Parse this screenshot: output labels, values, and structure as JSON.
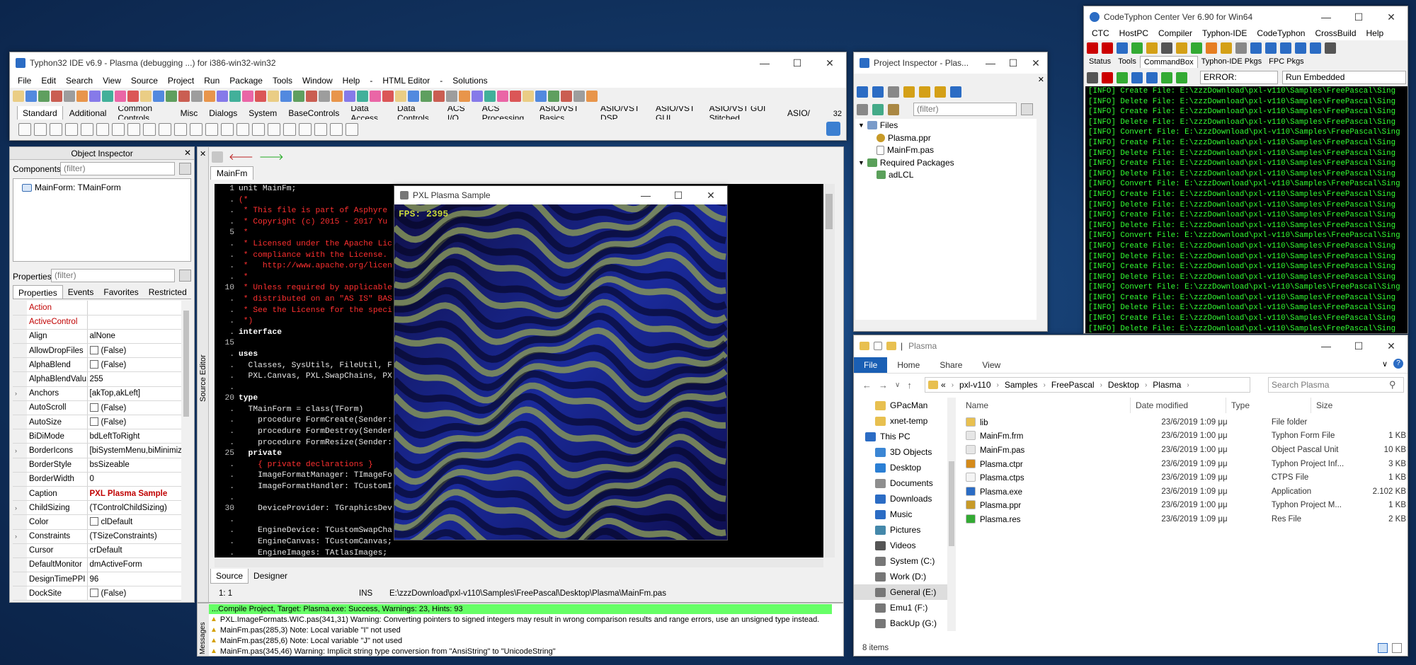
{
  "ide": {
    "title": "Typhon32 IDE v6.9 - Plasma (debugging ...) for i386-win32-win32",
    "menu": [
      "File",
      "Edit",
      "Search",
      "View",
      "Source",
      "Project",
      "Run",
      "Package",
      "Tools",
      "Window",
      "Help",
      "-",
      "HTML Editor",
      "-",
      "Solutions"
    ],
    "palette_tabs": [
      "Standard",
      "Additional",
      "Common Controls",
      "Misc",
      "Dialogs",
      "System",
      "BaseControls",
      "Data Access",
      "Data Controls",
      "ACS I/O",
      "ACS Processing",
      "ASIO/VST Basics",
      "ASIO/VST DSP",
      "ASIO/VST GUI",
      "ASIO/VST GUI Stitched",
      "ASIO/"
    ],
    "palette_count": "32"
  },
  "object_inspector": {
    "title": "Object Inspector",
    "components_label": "Components",
    "filter_placeholder": "(filter)",
    "tree_item": "MainForm: TMainForm",
    "properties_label": "Properties",
    "tabs": [
      "Properties",
      "Events",
      "Favorites",
      "Restricted"
    ],
    "props": [
      {
        "name": "Action",
        "value": "",
        "red": true
      },
      {
        "name": "ActiveControl",
        "value": "",
        "red": true
      },
      {
        "name": "Align",
        "value": "alNone"
      },
      {
        "name": "AllowDropFiles",
        "value": "(False)",
        "check": true
      },
      {
        "name": "AlphaBlend",
        "value": "(False)",
        "check": true
      },
      {
        "name": "AlphaBlendValu",
        "value": "255"
      },
      {
        "name": "Anchors",
        "value": "[akTop,akLeft]",
        "expand": true
      },
      {
        "name": "AutoScroll",
        "value": "(False)",
        "check": true
      },
      {
        "name": "AutoSize",
        "value": "(False)",
        "check": true
      },
      {
        "name": "BiDiMode",
        "value": "bdLeftToRight"
      },
      {
        "name": "BorderIcons",
        "value": "[biSystemMenu,biMinimize",
        "expand": true
      },
      {
        "name": "BorderStyle",
        "value": "bsSizeable"
      },
      {
        "name": "BorderWidth",
        "value": "0"
      },
      {
        "name": "Caption",
        "value": "PXL Plasma Sample",
        "redval": true
      },
      {
        "name": "ChildSizing",
        "value": "(TControlChildSizing)",
        "expand": true
      },
      {
        "name": "Color",
        "value": "clDefault",
        "swatch": true
      },
      {
        "name": "Constraints",
        "value": "(TSizeConstraints)",
        "expand": true
      },
      {
        "name": "Cursor",
        "value": "crDefault"
      },
      {
        "name": "DefaultMonitor",
        "value": "dmActiveForm"
      },
      {
        "name": "DesignTimePPI",
        "value": "96"
      },
      {
        "name": "DockSite",
        "value": "(False)",
        "check": true
      }
    ]
  },
  "editor": {
    "tab": "MainFm",
    "side_label": "Source Editor",
    "bottom_tabs": [
      "Source",
      "Designer"
    ],
    "status": {
      "pos": "1:  1",
      "mode": "INS",
      "path": "E:\\zzzDownload\\pxl-v110\\Samples\\FreePascal\\Desktop\\Plasma\\MainFm.pas"
    },
    "lines": [
      {
        "n": "1",
        "t": "unit MainFm;",
        "c": "w"
      },
      {
        "n": ".",
        "t": "(*",
        "c": "r"
      },
      {
        "n": ".",
        "t": " * This file is part of Asphyre",
        "c": "r"
      },
      {
        "n": ".",
        "t": " * Copyright (c) 2015 - 2017 Yu",
        "c": "r"
      },
      {
        "n": "5",
        "t": " *",
        "c": "r"
      },
      {
        "n": ".",
        "t": " * Licensed under the Apache Lic",
        "c": "r"
      },
      {
        "n": ".",
        "t": " * compliance with the License.",
        "c": "r"
      },
      {
        "n": ".",
        "t": " *   http://www.apache.org/licen",
        "c": "r"
      },
      {
        "n": ".",
        "t": " *",
        "c": "r"
      },
      {
        "n": "10",
        "t": " * Unless required by applicable",
        "c": "r"
      },
      {
        "n": ".",
        "t": " * distributed on an \"AS IS\" BAS                                            ed.",
        "c": "r"
      },
      {
        "n": ".",
        "t": " * See the License for the speci",
        "c": "r"
      },
      {
        "n": ".",
        "t": " *)",
        "c": "r"
      },
      {
        "n": ".",
        "t": "interface",
        "c": "k"
      },
      {
        "n": "15",
        "t": "",
        "c": "w"
      },
      {
        "n": ".",
        "t": "uses",
        "c": "k"
      },
      {
        "n": ".",
        "t": "  Classes, SysUtils, FileUtil, F                                        s, PXL.Devices,",
        "c": "w"
      },
      {
        "n": ".",
        "t": "  PXL.Canvas, PXL.SwapChains, PX",
        "c": "w"
      },
      {
        "n": ".",
        "t": "",
        "c": "w"
      },
      {
        "n": "20",
        "t": "type",
        "c": "k"
      },
      {
        "n": ".",
        "t": "  TMainForm = class(TForm)",
        "c": "w"
      },
      {
        "n": ".",
        "t": "    procedure FormCreate(Sender:",
        "c": "w"
      },
      {
        "n": ".",
        "t": "    procedure FormDestroy(Sender",
        "c": "w"
      },
      {
        "n": ".",
        "t": "    procedure FormResize(Sender:",
        "c": "w"
      },
      {
        "n": "25",
        "t": "  private",
        "c": "k"
      },
      {
        "n": ".",
        "t": "    { private declarations }",
        "c": "r"
      },
      {
        "n": ".",
        "t": "    ImageFormatManager: TImageFo",
        "c": "w"
      },
      {
        "n": ".",
        "t": "    ImageFormatHandler: TCustomI",
        "c": "w"
      },
      {
        "n": ".",
        "t": "",
        "c": "w"
      },
      {
        "n": "30",
        "t": "    DeviceProvider: TGraphicsDev",
        "c": "w"
      },
      {
        "n": ".",
        "t": "",
        "c": "w"
      },
      {
        "n": ".",
        "t": "    EngineDevice: TCustomSwapCha",
        "c": "w"
      },
      {
        "n": ".",
        "t": "    EngineCanvas: TCustomCanvas;",
        "c": "w"
      },
      {
        "n": ".",
        "t": "    EngineImages: TAtlasImages;",
        "c": "w"
      }
    ]
  },
  "messages": {
    "side_label": "Messages",
    "success": "...Compile Project, Target: Plasma.exe: Success, Warnings: 23, Hints: 93",
    "items": [
      "PXL.ImageFormats.WIC.pas(341,31) Warning: Converting pointers to signed integers may result in wrong comparison results and range errors, use an unsigned type instead.",
      "MainFm.pas(285,3) Note: Local variable \"I\" not used",
      "MainFm.pas(285,6) Note: Local variable \"J\" not used",
      "MainFm.pas(345,46) Warning: Implicit string type conversion from \"AnsiString\" to \"UnicodeString\""
    ]
  },
  "plasma": {
    "title": "PXL Plasma Sample",
    "fps": "FPS: 2395"
  },
  "project_inspector": {
    "title": "Project Inspector - Plas...",
    "filter_placeholder": "(filter)",
    "files_label": "Files",
    "files": [
      "Plasma.ppr",
      "MainFm.pas"
    ],
    "req_label": "Required Packages",
    "packages": [
      "adLCL"
    ]
  },
  "ctc": {
    "title": "CodeTyphon Center Ver 6.90 for Win64",
    "menu": [
      "CTC",
      "HostPC",
      "Compiler",
      "Typhon-IDE",
      "CodeTyphon",
      "CrossBuild",
      "Help"
    ],
    "tabs": [
      "Status",
      "Tools",
      "CommandBox",
      "Typhon-IDE Pkgs",
      "FPC Pkgs"
    ],
    "level": "ERROR:",
    "run_mode": "Run Embedded",
    "log": [
      "[INFO] Create File: E:\\zzzDownload\\pxl-v110\\Samples\\FreePascal\\Sing",
      "[INFO] Delete File: E:\\zzzDownload\\pxl-v110\\Samples\\FreePascal\\Sing",
      "[INFO] Create File: E:\\zzzDownload\\pxl-v110\\Samples\\FreePascal\\Sing",
      "[INFO] Delete File: E:\\zzzDownload\\pxl-v110\\Samples\\FreePascal\\Sing",
      "[INFO] Convert File: E:\\zzzDownload\\pxl-v110\\Samples\\FreePascal\\Sing",
      "[INFO] Create File: E:\\zzzDownload\\pxl-v110\\Samples\\FreePascal\\Sing",
      "[INFO] Delete File: E:\\zzzDownload\\pxl-v110\\Samples\\FreePascal\\Sing",
      "[INFO] Create File: E:\\zzzDownload\\pxl-v110\\Samples\\FreePascal\\Sing",
      "[INFO] Delete File: E:\\zzzDownload\\pxl-v110\\Samples\\FreePascal\\Sing",
      "[INFO] Convert File: E:\\zzzDownload\\pxl-v110\\Samples\\FreePascal\\Sing",
      "[INFO] Create File: E:\\zzzDownload\\pxl-v110\\Samples\\FreePascal\\Sing",
      "[INFO] Delete File: E:\\zzzDownload\\pxl-v110\\Samples\\FreePascal\\Sing",
      "[INFO] Create File: E:\\zzzDownload\\pxl-v110\\Samples\\FreePascal\\Sing",
      "[INFO] Delete File: E:\\zzzDownload\\pxl-v110\\Samples\\FreePascal\\Sing",
      "[INFO] Convert File: E:\\zzzDownload\\pxl-v110\\Samples\\FreePascal\\Sing",
      "[INFO] Create File: E:\\zzzDownload\\pxl-v110\\Samples\\FreePascal\\Sing",
      "[INFO] Delete File: E:\\zzzDownload\\pxl-v110\\Samples\\FreePascal\\Sing",
      "[INFO] Create File: E:\\zzzDownload\\pxl-v110\\Samples\\FreePascal\\Sing",
      "[INFO] Delete File: E:\\zzzDownload\\pxl-v110\\Samples\\FreePascal\\Sing",
      "[INFO] Convert File: E:\\zzzDownload\\pxl-v110\\Samples\\FreePascal\\Sing",
      "[INFO] Create File: E:\\zzzDownload\\pxl-v110\\Samples\\FreePascal\\Sing",
      "[INFO] Delete File: E:\\zzzDownload\\pxl-v110\\Samples\\FreePascal\\Sing",
      "[INFO] Create File: E:\\zzzDownload\\pxl-v110\\Samples\\FreePascal\\Sing",
      "[INFO] Delete File: E:\\zzzDownload\\pxl-v110\\Samples\\FreePascal\\Sing"
    ]
  },
  "explorer": {
    "title": "Plasma",
    "ribbon": [
      "File",
      "Home",
      "Share",
      "View"
    ],
    "breadcrumb": [
      "«",
      "pxl-v110",
      "Samples",
      "FreePascal",
      "Desktop",
      "Plasma"
    ],
    "search_placeholder": "Search Plasma",
    "columns": [
      "Name",
      "Date modified",
      "Type",
      "Size"
    ],
    "nav": [
      {
        "label": "GPacMan",
        "icon": "folder-icon"
      },
      {
        "label": "xnet-temp",
        "icon": "folder-icon"
      },
      {
        "label": "This PC",
        "icon": "pc-icon"
      },
      {
        "label": "3D Objects",
        "icon": "cube-icon"
      },
      {
        "label": "Desktop",
        "icon": "desktop-icon"
      },
      {
        "label": "Documents",
        "icon": "document-icon"
      },
      {
        "label": "Downloads",
        "icon": "download-icon"
      },
      {
        "label": "Music",
        "icon": "music-icon"
      },
      {
        "label": "Pictures",
        "icon": "picture-icon"
      },
      {
        "label": "Videos",
        "icon": "video-icon"
      },
      {
        "label": "System (C:)",
        "icon": "drive-icon"
      },
      {
        "label": "Work (D:)",
        "icon": "drive-icon"
      },
      {
        "label": "General (E:)",
        "icon": "drive-icon"
      },
      {
        "label": "Emu1 (F:)",
        "icon": "drive-icon"
      },
      {
        "label": "BackUp (G:)",
        "icon": "drive-icon"
      }
    ],
    "files": [
      {
        "name": "lib",
        "date": "23/6/2019 1:09 μμ",
        "type": "File folder",
        "size": ""
      },
      {
        "name": "MainFm.frm",
        "date": "23/6/2019 1:00 μμ",
        "type": "Typhon Form File",
        "size": "1 KB"
      },
      {
        "name": "MainFm.pas",
        "date": "23/6/2019 1:00 μμ",
        "type": "Object Pascal Unit",
        "size": "10 KB"
      },
      {
        "name": "Plasma.ctpr",
        "date": "23/6/2019 1:09 μμ",
        "type": "Typhon Project Inf...",
        "size": "3 KB"
      },
      {
        "name": "Plasma.ctps",
        "date": "23/6/2019 1:09 μμ",
        "type": "CTPS File",
        "size": "1 KB"
      },
      {
        "name": "Plasma.exe",
        "date": "23/6/2019 1:09 μμ",
        "type": "Application",
        "size": "2.102 KB"
      },
      {
        "name": "Plasma.ppr",
        "date": "23/6/2019 1:00 μμ",
        "type": "Typhon Project M...",
        "size": "1 KB"
      },
      {
        "name": "Plasma.res",
        "date": "23/6/2019 1:09 μμ",
        "type": "Res File",
        "size": "2 KB"
      }
    ],
    "status": "8 items"
  }
}
